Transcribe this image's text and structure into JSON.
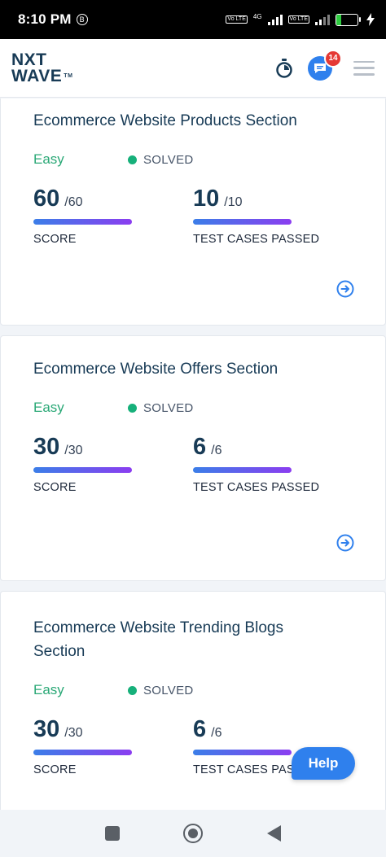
{
  "status_bar": {
    "time": "8:10 PM",
    "notification_badge": "B",
    "network_label": "4G",
    "volte_label": "Vo LTE",
    "battery_level": "23",
    "battery_fill_percent": 23
  },
  "header": {
    "logo_line1": "NXT",
    "logo_line2": "WAVE",
    "logo_tm": "TM",
    "chat_badge_count": "14",
    "icons": [
      "stopwatch-icon",
      "chat-icon",
      "hamburger-menu-icon"
    ]
  },
  "problems": [
    {
      "title": "Ecommerce Website Products Section",
      "difficulty": "Easy",
      "status": "SOLVED",
      "score": "60",
      "score_total": "/60",
      "score_label": "SCORE",
      "tests": "10",
      "tests_total": "/10",
      "tests_label": "TEST CASES PASSED"
    },
    {
      "title": "Ecommerce Website Offers Section",
      "difficulty": "Easy",
      "status": "SOLVED",
      "score": "30",
      "score_total": "/30",
      "score_label": "SCORE",
      "tests": "6",
      "tests_total": "/6",
      "tests_label": "TEST CASES PASSED"
    },
    {
      "title": "Ecommerce Website Trending Blogs Section",
      "difficulty": "Easy",
      "status": "SOLVED",
      "score": "30",
      "score_total": "/30",
      "score_label": "SCORE",
      "tests": "6",
      "tests_total": "/6",
      "tests_label": "TEST CASES PASSED"
    }
  ],
  "help_button": "Help",
  "colors": {
    "primary": "#183b56",
    "easy": "#2aa876",
    "solved_dot": "#16b07a",
    "accent": "#2f80ed",
    "bar_start": "#3b7ee8",
    "bar_end": "#8b3df0"
  }
}
